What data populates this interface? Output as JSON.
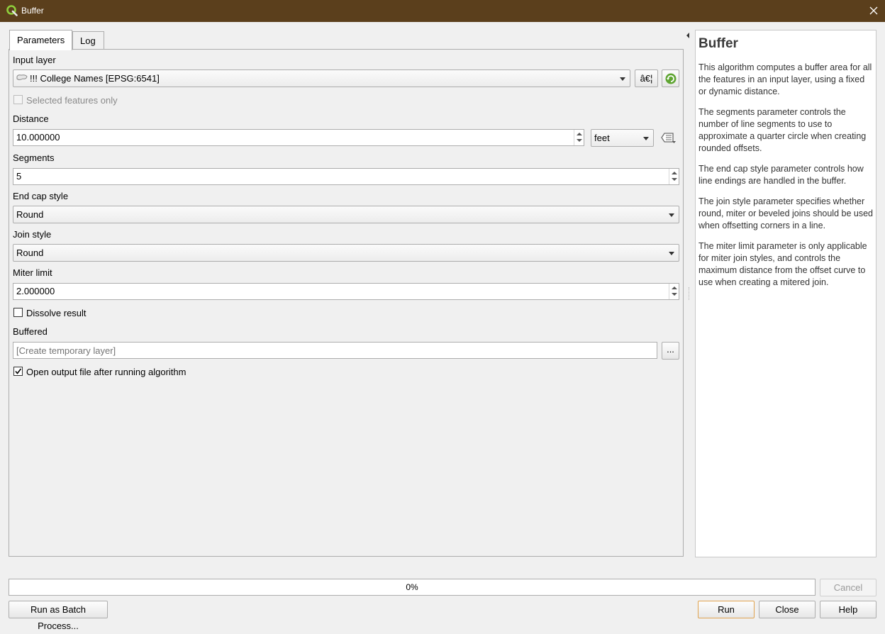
{
  "window": {
    "title": "Buffer",
    "title_bar_color": "#5b3f1c"
  },
  "tabs": [
    {
      "label": "Parameters",
      "active": true
    },
    {
      "label": "Log",
      "active": false
    }
  ],
  "params": {
    "input_layer_label": "Input layer",
    "input_layer_value": "!!! College Names [EPSG:6541]",
    "input_layer_browse_label": "â€¦",
    "selected_only_label": "Selected features only",
    "distance_label": "Distance",
    "distance_value": "10.000000",
    "distance_unit": "feet",
    "segments_label": "Segments",
    "segments_value": "5",
    "end_cap_label": "End cap style",
    "end_cap_value": "Round",
    "join_style_label": "Join style",
    "join_style_value": "Round",
    "miter_label": "Miter limit",
    "miter_value": "2.000000",
    "dissolve_label": "Dissolve result",
    "buffered_label": "Buffered",
    "buffered_placeholder": "[Create temporary layer]",
    "buffered_browse_label": "...",
    "open_output_label": "Open output file after running algorithm"
  },
  "help": {
    "title": "Buffer",
    "paragraphs": [
      "This algorithm computes a buffer area for all the features in an input layer, using a fixed or dynamic distance.",
      "The segments parameter controls the number of line segments to use to approximate a quarter circle when creating rounded offsets.",
      "The end cap style parameter controls how line endings are handled in the buffer.",
      "The join style parameter specifies whether round, miter or beveled joins should be used when offsetting corners in a line.",
      "The miter limit parameter is only applicable for miter join styles, and controls the maximum distance from the offset curve to use when creating a mitered join."
    ]
  },
  "footer": {
    "progress_text": "0%",
    "progress_value": 0,
    "cancel_label": "Cancel",
    "batch_label": "Run as Batch Process...",
    "run_label": "Run",
    "close_label": "Close",
    "help_label": "Help"
  },
  "icons": {
    "app": "qgis-logo-icon",
    "close": "close-icon",
    "polygon_layer": "polygon-layer-icon",
    "iterate": "iterate-features-icon",
    "data_defined": "data-defined-override-icon"
  }
}
